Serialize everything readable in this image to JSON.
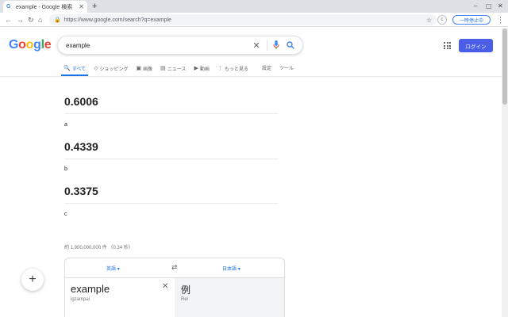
{
  "browser": {
    "tab_title": "example - Google 検索",
    "tab_favicon": "G",
    "newtab_label": "+",
    "url": "https://www.google.com/search?q=example",
    "pause_label": "一時停止中",
    "ext_label": "c",
    "window_controls": [
      "–",
      "▢",
      "✕"
    ]
  },
  "google": {
    "logo": [
      "G",
      "o",
      "o",
      "g",
      "l",
      "e"
    ],
    "query": "example",
    "login_label": "ログイン",
    "tabs": [
      {
        "icon": "🔍",
        "label": "すべて"
      },
      {
        "icon": "◇",
        "label": "ショッピング"
      },
      {
        "icon": "▣",
        "label": "画像"
      },
      {
        "icon": "▤",
        "label": "ニュース"
      },
      {
        "icon": "▶",
        "label": "動画"
      },
      {
        "icon": "⋮",
        "label": "もっと見る"
      }
    ],
    "settings_label": "設定",
    "tools_label": "ツール"
  },
  "results": [
    {
      "value": "0.6006",
      "label": "a"
    },
    {
      "value": "0.4339",
      "label": "b"
    },
    {
      "value": "0.3375",
      "label": "c"
    }
  ],
  "stats": "約 1,900,000,000 件 （0.34 秒）",
  "translate": {
    "source_lang": "英語",
    "target_lang": "日本語",
    "swap_icon": "⇄",
    "source_text": "example",
    "source_roman": "igzampəl",
    "target_text": "例",
    "target_roman": "Rei"
  },
  "colors": {
    "accent": "#1a73e8",
    "login_bg": "#4a5ee8"
  }
}
